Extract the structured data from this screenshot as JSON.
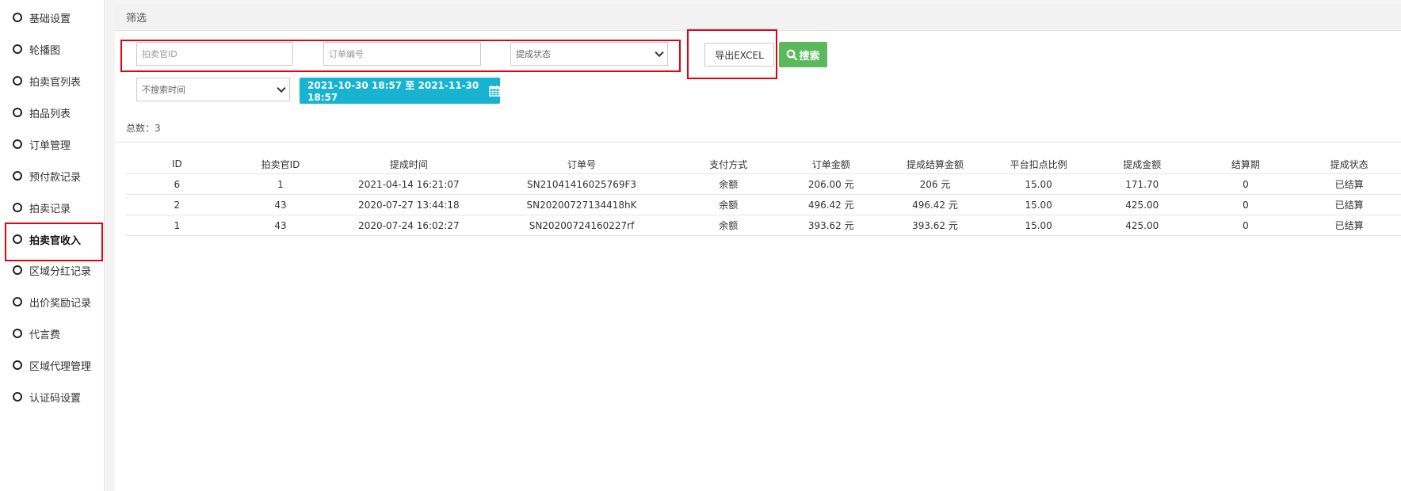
{
  "sidebar": {
    "items": [
      {
        "label": "基础设置"
      },
      {
        "label": "轮播图"
      },
      {
        "label": "拍卖官列表"
      },
      {
        "label": "拍品列表"
      },
      {
        "label": "订单管理"
      },
      {
        "label": "预付款记录"
      },
      {
        "label": "拍卖记录"
      },
      {
        "label": "拍卖官收入"
      },
      {
        "label": "区域分红记录"
      },
      {
        "label": "出价奖励记录"
      },
      {
        "label": "代言费"
      },
      {
        "label": "区域代理管理"
      },
      {
        "label": "认证码设置"
      }
    ],
    "active_index": 7
  },
  "filter": {
    "title": "筛选",
    "auctioneer_id_placeholder": "拍卖官ID",
    "order_no_placeholder": "订单编号",
    "status_select_value": "提成状态",
    "time_select_value": "不搜索时间",
    "export_label": "导出EXCEL",
    "search_label": "搜索",
    "date_range_label": "2021-10-30 18:57 至 2021-11-30 18:57"
  },
  "summary": {
    "total_label": "总数：3"
  },
  "table": {
    "headers": [
      "ID",
      "拍卖官ID",
      "提成时间",
      "订单号",
      "支付方式",
      "订单金额",
      "提成结算金额",
      "平台扣点比例",
      "提成金额",
      "结算期",
      "提成状态"
    ],
    "rows": [
      [
        "6",
        "1",
        "2021-04-14 16:21:07",
        "SN21041416025769F3",
        "余额",
        "206.00 元",
        "206 元",
        "15.00",
        "171.70",
        "0",
        "已结算"
      ],
      [
        "2",
        "43",
        "2020-07-27 13:44:18",
        "SN20200727134418hK",
        "余额",
        "496.42 元",
        "496.42 元",
        "15.00",
        "425.00",
        "0",
        "已结算"
      ],
      [
        "1",
        "43",
        "2020-07-24 16:02:27",
        "SN20200724160227rf",
        "余额",
        "393.62 元",
        "393.62 元",
        "15.00",
        "425.00",
        "0",
        "已结算"
      ]
    ]
  },
  "colors": {
    "accent_search": "#5cb85c",
    "accent_date": "#17b3d1",
    "highlight_box": "#e60012"
  },
  "icons": {
    "sidebar_item": "circle-icon",
    "search": "search-icon",
    "calendar": "calendar-icon",
    "select_arrow": "chevron-down-icon"
  }
}
